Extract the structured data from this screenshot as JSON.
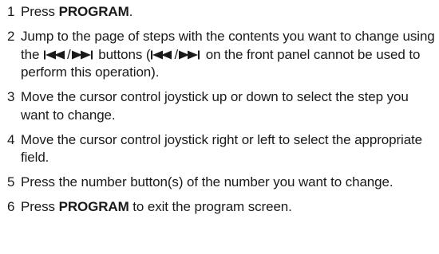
{
  "steps": [
    {
      "number": "1",
      "text_before": "Press ",
      "bold": "PROGRAM",
      "text_after": "."
    },
    {
      "number": "2",
      "text_part1": "Jump to the page of steps with the contents you want to change using the ",
      "separator_1": "/",
      "text_part2": " buttons (",
      "separator_2": "/",
      "text_part3": " on the front panel cannot be used to perform this operation).",
      "icons": [
        "skip-previous-icon",
        "skip-next-icon"
      ]
    },
    {
      "number": "3",
      "text": "Move the cursor control joystick up or down to select the step you want to change."
    },
    {
      "number": "4",
      "text": "Move the cursor control joystick right or left to select the appropriate field."
    },
    {
      "number": "5",
      "text": "Press the number button(s) of the number you want to change."
    },
    {
      "number": "6",
      "text_before": "Press ",
      "bold": "PROGRAM",
      "text_after": " to exit the program screen."
    }
  ]
}
